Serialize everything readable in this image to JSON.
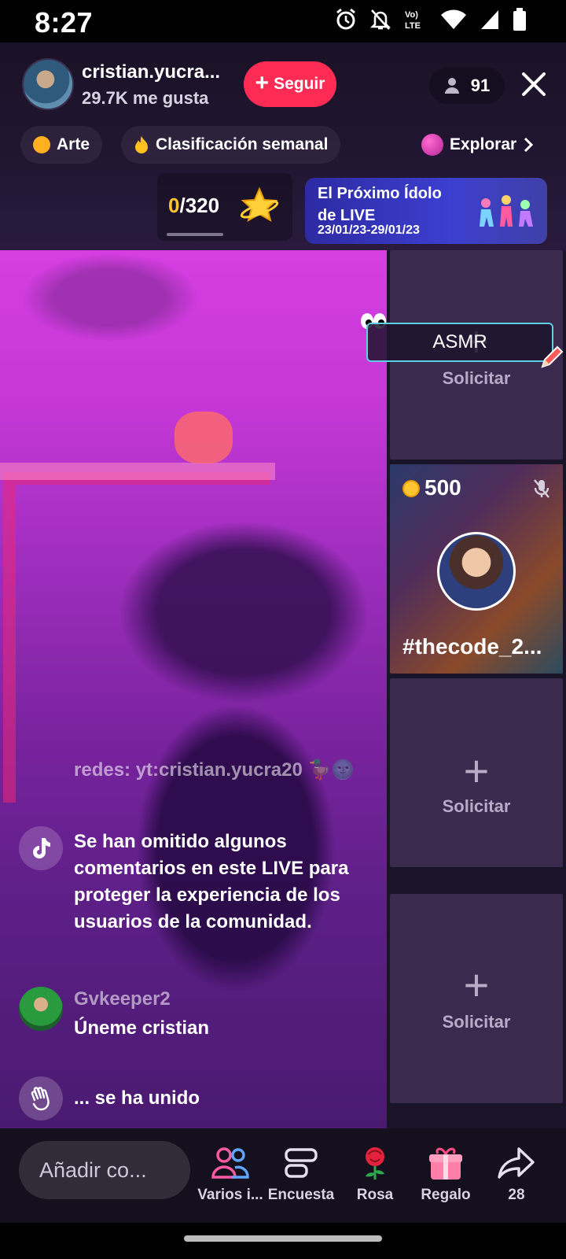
{
  "status_bar": {
    "time": "8:27",
    "icons": [
      "alarm-icon",
      "bell-off-icon",
      "volte-icon",
      "wifi-icon",
      "signal-icon",
      "battery-icon"
    ],
    "network_label": "Vo) LTE"
  },
  "header": {
    "host_name": "cristian.yucra...",
    "likes": "29.7K me gusta",
    "follow_label": "Seguir",
    "viewer_count": "91"
  },
  "chips": [
    {
      "label": "Arte",
      "icon": "hashtag-badge-icon"
    },
    {
      "label": "Clasificación semanal",
      "icon": "flame-icon"
    },
    {
      "label": "Explorar",
      "icon": "planet-icon"
    }
  ],
  "progress": {
    "current": "0",
    "total": "/320"
  },
  "promo": {
    "title": "El Próximo Ídolo de LIVE",
    "dates": "23/01/23-29/01/23"
  },
  "guests": {
    "tag": "ASMR",
    "slots": [
      {
        "label": "Solicitar"
      },
      {
        "coins": "500",
        "name": "#thecode_2..."
      },
      {
        "label": "Solicitar"
      },
      {
        "label": "Solicitar"
      }
    ]
  },
  "comments": {
    "top_fade": "redes: yt:cristian.yucra20 🦆🌚",
    "notice": "Se han omitido algunos comentarios en este LIVE para proteger la experiencia de los usuarios de la comunidad.",
    "user_name": "Gvkeeper2",
    "user_text": "Úneme cristian",
    "join_text": "... se ha unido"
  },
  "bottom": {
    "input_placeholder": "Añadir co...",
    "actions": [
      {
        "label": "Varios i...",
        "icon": "multi-guest-icon"
      },
      {
        "label": "Encuesta",
        "icon": "poll-icon"
      },
      {
        "label": "Rosa",
        "icon": "rose-icon"
      },
      {
        "label": "Regalo",
        "icon": "gift-icon"
      },
      {
        "label": "28",
        "icon": "share-icon"
      }
    ]
  },
  "colors": {
    "accent": "#fe2c55",
    "coin": "#ffc530",
    "tag_border": "#5fd0e4"
  }
}
